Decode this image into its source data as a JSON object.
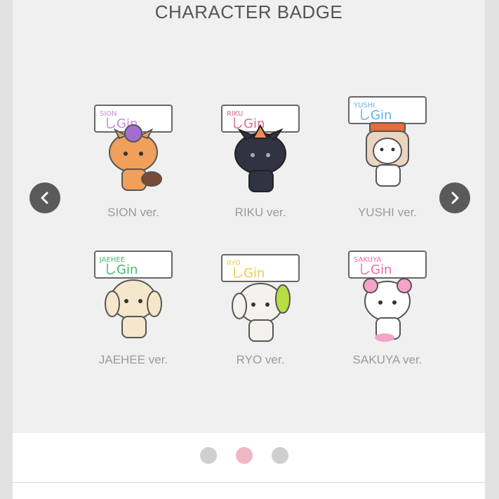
{
  "section": {
    "title": "CHARACTER BADGE"
  },
  "badges": [
    {
      "name": "SION ver.",
      "color": "#f0a05a",
      "text_color": "#c48ad9"
    },
    {
      "name": "RIKU ver.",
      "color": "#2f3342",
      "text_color": "#e06a8a"
    },
    {
      "name": "YUSHI ver.",
      "color": "#f4f0ec",
      "text_color": "#60b2e8"
    },
    {
      "name": "JAEHEE ver.",
      "color": "#f5e7cc",
      "text_color": "#46b96b"
    },
    {
      "name": "RYO ver.",
      "color": "#f4f2ec",
      "text_color": "#e4ce4c"
    },
    {
      "name": "SAKUYA ver.",
      "color": "#ffffff",
      "text_color": "#ef6aa7"
    }
  ],
  "navigation": {
    "prev_icon": "chevron-left-icon",
    "next_icon": "chevron-right-icon"
  },
  "pagination": {
    "current": 2,
    "total": 3,
    "active_color": "#f1b6c6",
    "inactive_color": "#cfcfcf"
  }
}
